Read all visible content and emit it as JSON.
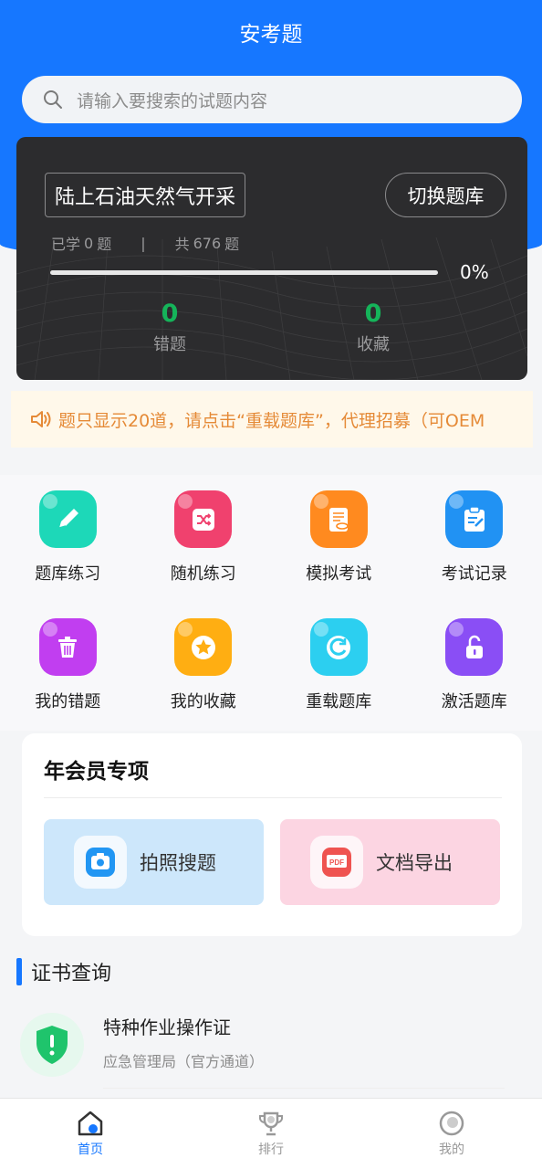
{
  "header": {
    "title": "安考题"
  },
  "search": {
    "placeholder": "请输入要搜索的试题内容"
  },
  "bank_card": {
    "bank_name": "陆上石油天然气开采",
    "switch_label": "切换题库",
    "learned_prefix": "已学",
    "learned_count": "0",
    "learned_unit": "题",
    "separator": "|",
    "total_prefix": "共",
    "total_count": "676",
    "total_unit": "题",
    "progress_percent": "0%",
    "progress_value": 0,
    "wrong_count": "0",
    "wrong_label": "错题",
    "fav_count": "0",
    "fav_label": "收藏"
  },
  "notice": {
    "text": "题只显示20道，请点击“重载题库”，代理招募（可OEM"
  },
  "features": [
    {
      "label": "题库练习",
      "icon": "pencil-icon",
      "color": "#1dd8b8"
    },
    {
      "label": "随机练习",
      "icon": "shuffle-icon",
      "color": "#f0416e"
    },
    {
      "label": "模拟考试",
      "icon": "exam-paper-icon",
      "color": "#ff8a1f"
    },
    {
      "label": "考试记录",
      "icon": "clipboard-icon",
      "color": "#2192f3"
    },
    {
      "label": "我的错题",
      "icon": "trash-icon",
      "color": "#c13ef0"
    },
    {
      "label": "我的收藏",
      "icon": "star-icon",
      "color": "#ffae12"
    },
    {
      "label": "重载题库",
      "icon": "reload-icon",
      "color": "#2ccff0"
    },
    {
      "label": "激活题库",
      "icon": "unlock-icon",
      "color": "#8a4ef5"
    }
  ],
  "member": {
    "title": "年会员专项",
    "photo_search": "拍照搜题",
    "doc_export": "文档导出",
    "pdf_badge": "PDF",
    "photo_color": "#cde7fb",
    "doc_color": "#fcd5e2"
  },
  "cert": {
    "title": "证书查询",
    "item_name": "特种作业操作证",
    "item_sub": "应急管理局（官方通道）"
  },
  "tabbar": {
    "home": "首页",
    "rank": "排行",
    "mine": "我的",
    "active_color": "#1677ff"
  }
}
